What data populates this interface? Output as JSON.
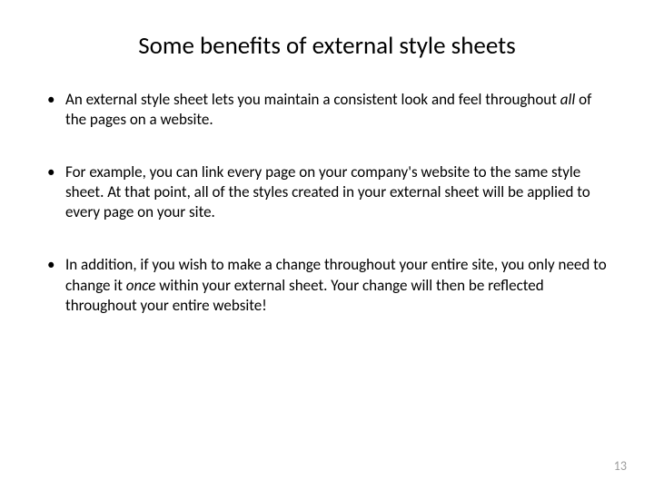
{
  "title": "Some benefits of external style sheets",
  "bullets": [
    {
      "pre": "An external style sheet lets you maintain a consistent look and feel throughout ",
      "italic": "all",
      "post": " of the pages on a website."
    },
    {
      "pre": "For example, you can link every page on your company's website to the same style sheet. At that point, all of the styles created in your external sheet will be applied to every page on your site.",
      "italic": "",
      "post": ""
    },
    {
      "pre": "In addition, if you wish to make a change throughout your entire site, you only need to change it ",
      "italic": "once",
      "post": " within your external sheet. Your change will then be reflected throughout your entire website!"
    }
  ],
  "bullet_marker": "•",
  "page_number": "13"
}
